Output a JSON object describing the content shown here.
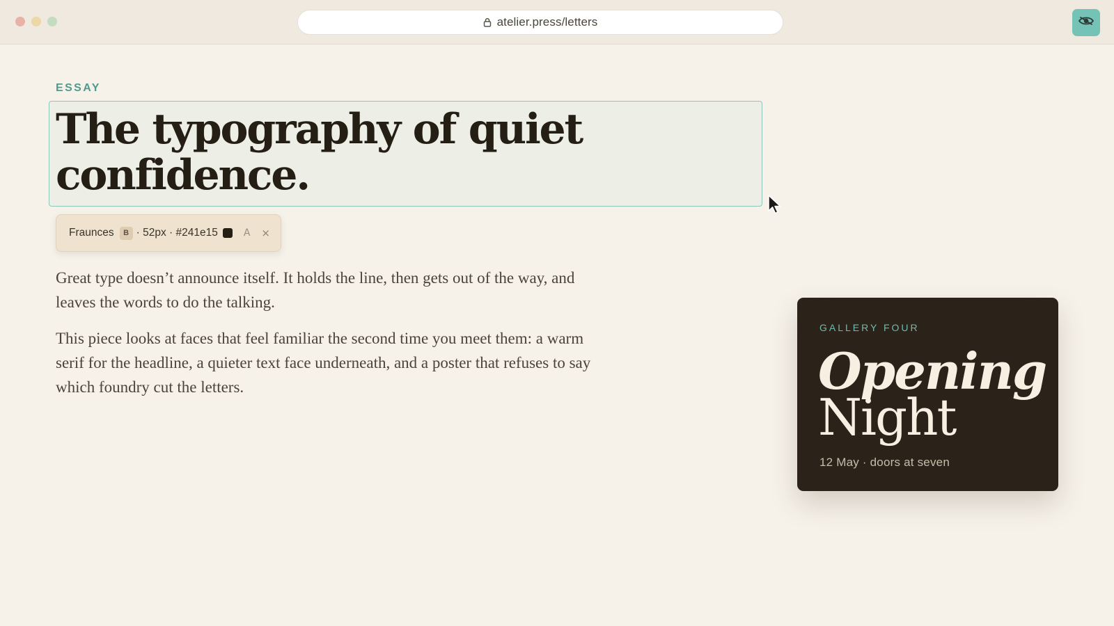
{
  "browser": {
    "url": "atelier.press/letters",
    "extension_icon": "eye-slash-icon"
  },
  "article": {
    "eyebrow": "ESSAY",
    "headline_line1": "The typography of quiet",
    "headline_line2": "confidence.",
    "paragraphs": [
      "Great type doesn’t announce itself. It holds the line, then gets out of the way, and leaves the words to do the talking.",
      "This piece looks at faces that feel familiar the second time you meet them: a warm serif for the headline, a quieter text face underneath, and a poster that refuses to say which foundry cut the letters."
    ]
  },
  "font_inspector": {
    "font_name": "Fraunces",
    "weight_badge": "B",
    "meta": "· 52px · #241e15",
    "swatch_color": "#241e15",
    "glyph": "A",
    "close": "×"
  },
  "poster": {
    "eyebrow": "GALLERY FOUR",
    "title_line1": "Opening",
    "title_line2": "Night",
    "subtitle": "12 May · doors at seven"
  },
  "colors": {
    "accent": "#4f9a8d",
    "ink": "#241e15",
    "paper": "#f6f2ea",
    "poster_bg": "#2b221a",
    "extension_bg": "#75c3b7"
  }
}
